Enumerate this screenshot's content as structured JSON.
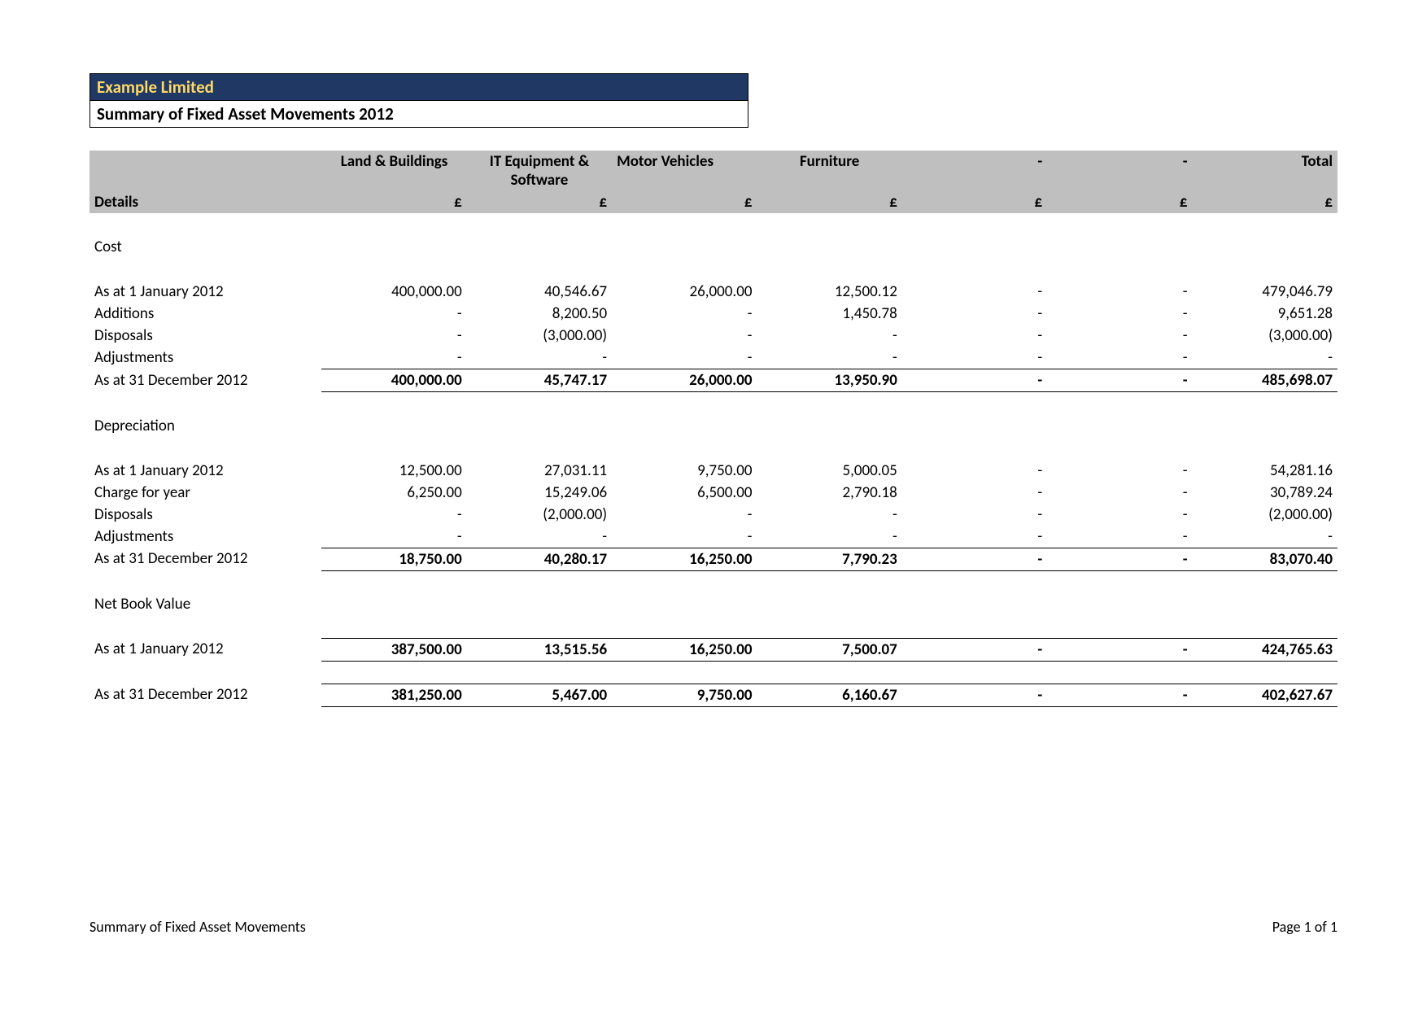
{
  "company": "Example Limited",
  "title": "Summary of Fixed Asset Movements 2012",
  "columns": {
    "details": "Details",
    "c1": "Land & Buildings",
    "c2": "IT Equipment & Software",
    "c3": "Motor Vehicles",
    "c4": "Furniture",
    "c5": "-",
    "c6": "-",
    "total": "Total"
  },
  "currency": "£",
  "sections": {
    "cost": {
      "label": "Cost",
      "rows": {
        "opening": {
          "label": "As at 1 January 2012",
          "c1": "400,000.00",
          "c2": "40,546.67",
          "c3": "26,000.00",
          "c4": "12,500.12",
          "c5": "-",
          "c6": "-",
          "total": "479,046.79"
        },
        "additions": {
          "label": "Additions",
          "c1": "-",
          "c2": "8,200.50",
          "c3": "-",
          "c4": "1,450.78",
          "c5": "-",
          "c6": "-",
          "total": "9,651.28"
        },
        "disposals": {
          "label": "Disposals",
          "c1": "-",
          "c2": "(3,000.00)",
          "c3": "-",
          "c4": "-",
          "c5": "-",
          "c6": "-",
          "total": "(3,000.00)"
        },
        "adjustments": {
          "label": "Adjustments",
          "c1": "-",
          "c2": "-",
          "c3": "-",
          "c4": "-",
          "c5": "-",
          "c6": "-",
          "total": "-"
        },
        "closing": {
          "label": "As at 31 December 2012",
          "c1": "400,000.00",
          "c2": "45,747.17",
          "c3": "26,000.00",
          "c4": "13,950.90",
          "c5": "-",
          "c6": "-",
          "total": "485,698.07"
        }
      }
    },
    "dep": {
      "label": "Depreciation",
      "rows": {
        "opening": {
          "label": "As at 1 January 2012",
          "c1": "12,500.00",
          "c2": "27,031.11",
          "c3": "9,750.00",
          "c4": "5,000.05",
          "c5": "-",
          "c6": "-",
          "total": "54,281.16"
        },
        "charge": {
          "label": "Charge for year",
          "c1": "6,250.00",
          "c2": "15,249.06",
          "c3": "6,500.00",
          "c4": "2,790.18",
          "c5": "-",
          "c6": "-",
          "total": "30,789.24"
        },
        "disposals": {
          "label": "Disposals",
          "c1": "-",
          "c2": "(2,000.00)",
          "c3": "-",
          "c4": "-",
          "c5": "-",
          "c6": "-",
          "total": "(2,000.00)"
        },
        "adjustments": {
          "label": "Adjustments",
          "c1": "-",
          "c2": "-",
          "c3": "-",
          "c4": "-",
          "c5": "-",
          "c6": "-",
          "total": "-"
        },
        "closing": {
          "label": "As at 31 December 2012",
          "c1": "18,750.00",
          "c2": "40,280.17",
          "c3": "16,250.00",
          "c4": "7,790.23",
          "c5": "-",
          "c6": "-",
          "total": "83,070.40"
        }
      }
    },
    "nbv": {
      "label": "Net Book Value",
      "rows": {
        "opening": {
          "label": "As at 1 January 2012",
          "c1": "387,500.00",
          "c2": "13,515.56",
          "c3": "16,250.00",
          "c4": "7,500.07",
          "c5": "-",
          "c6": "-",
          "total": "424,765.63"
        },
        "closing": {
          "label": "As at 31 December 2012",
          "c1": "381,250.00",
          "c2": "5,467.00",
          "c3": "9,750.00",
          "c4": "6,160.67",
          "c5": "-",
          "c6": "-",
          "total": "402,627.67"
        }
      }
    }
  },
  "footer": {
    "left": "Summary of Fixed Asset Movements",
    "right": "Page 1 of 1"
  }
}
